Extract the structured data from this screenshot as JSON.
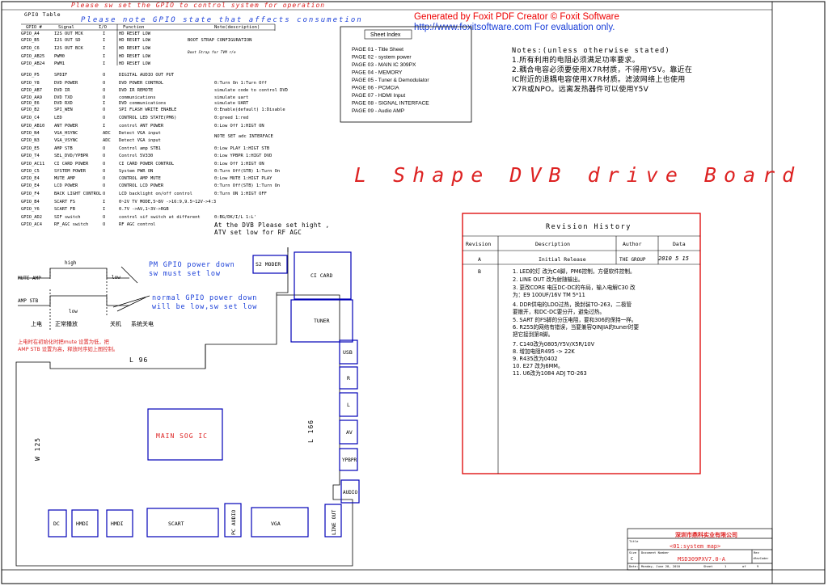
{
  "header": {
    "top_red_note": "Please sw set the GPIO to control system for operation",
    "foxit_line1": "Generated by Foxit PDF Creator © Foxit Software",
    "foxit_line2": "http://www.foxitsoftware.com   For evaluation only."
  },
  "gpio": {
    "table_title": "GPIO Table",
    "note": "Please note GPIO state that affects consumetion",
    "headers": [
      "GPIO #",
      "Signal",
      "I/O",
      "Function",
      "Note(description)"
    ],
    "boot_strap": "BOOT STRAP CONFIGURATION",
    "boot_strap_sub": "Boot Strap for TVM r/e",
    "rows": [
      [
        "GPIO_A4",
        "I2S OUT MCK",
        "I",
        "HD RESET LOW",
        ""
      ],
      [
        "GPIO_B5",
        "I2S OUT SD",
        "I",
        "HD RESET LOW",
        ""
      ],
      [
        "GPIO_C6",
        "I2S OUT BCK",
        "I",
        "HD RESET LOW",
        ""
      ],
      [
        "GPIO_AB25",
        "PWM0",
        "I",
        "HD RESET LOW",
        ""
      ],
      [
        "GPIO_AB24",
        "PWM1",
        "I",
        "HD RESET LOW",
        ""
      ],
      [
        "GPIO_P5",
        "SPDIF",
        "O",
        "DIGITAL AUDIO OUT PUT",
        ""
      ],
      [
        "GPIO_Y8",
        "DVD POWER",
        "O",
        "DVD POWER CONTROL",
        "0:Turn On 1:Turn Off"
      ],
      [
        "GPIO_AB7",
        "DVD IR",
        "O",
        "DVD IR REMOTE",
        "simulate code to control DVD"
      ],
      [
        "GPIO_AA9",
        "DVD TXD",
        "O",
        "communications",
        "simulate uart"
      ],
      [
        "GPIO_E6",
        "DVD RXD",
        "I",
        "DVD communications",
        "simulate UART"
      ],
      [
        "GPIO_B2",
        "SPI_WEN",
        "O",
        "SPI FLASH WRITE ENABLE",
        "0:Enable(default) 1:Disable"
      ],
      [
        "GPIO_C4",
        "LED",
        "O",
        "CONTROL LED STATE(PM6)",
        "0:greed 1:red"
      ],
      [
        "GPIO_AB10",
        "ANT POWER",
        "I",
        "control ANT POWER",
        "0:Low Off    1:HIGT ON"
      ],
      [
        "GPIO_N4",
        "VGA_HSYNC",
        "ADC",
        "Detect VGA input",
        ""
      ],
      [
        "GPIO_N3",
        "VGA_VSYNC",
        "ADC",
        "Detect VGA input",
        ""
      ],
      [
        "GPIO_E5",
        "AMP STB",
        "O",
        "Control amp STB1",
        "0:Low PLAY    1:HIGT STB"
      ],
      [
        "GPIO_T4",
        "SEL_DVD/YPBPR",
        "O",
        "Control 5V330",
        "0:Low YPBPR   1:HIGT DVD"
      ],
      [
        "GPIO_AC11",
        "CI CARD POWER",
        "O",
        "CI CARD POWER CONTROL",
        "0:Low Off    1:HIGT ON"
      ],
      [
        "GPIO_C5",
        "SYSTEM POWER",
        "O",
        "System PWR ON",
        "0:Turn Off(STB)  1:Turn On"
      ],
      [
        "GPIO_E4",
        "MUTE AMP",
        "O",
        "CONTROL AMP MUTE",
        "0:Low MUTE  1:HIGT PLAY"
      ],
      [
        "GPIO_E4",
        "LCD POWER",
        "O",
        "CONTROL LCD POWER",
        "0:Turn Off(STB)  1:Turn On"
      ],
      [
        "GPIO_F4",
        "BACK LIGHT CONTROL",
        "O",
        "LCD backlight on/off control",
        "0:Turn ON  1:HIGT OFF"
      ],
      [
        "GPIO_B4",
        "SCART FS",
        "I",
        "0~2V TV MODE,5~8V ->16:9,9.5~12V->4:3",
        ""
      ],
      [
        "GPIO_Y6",
        "SCART FB",
        "I",
        "0.7V ->AV,1~3V->RGB",
        ""
      ],
      [
        "GPIO_AD2",
        "SIF switch",
        "O",
        "control sif switch at different",
        "0:BG/DK/I/L   1:L'"
      ],
      [
        "GPIO_AC4",
        "RF_AGC  switch",
        "O",
        "RF AGC control",
        ""
      ]
    ],
    "adc_note": "NOTE SET adc INTERFACE",
    "dvb_note_1": "At the DVB Please set hight ,",
    "dvb_note_2": "ATV set low for RF AGC"
  },
  "sheet_index": {
    "title": "Sheet Index",
    "pages": [
      "PAGE 01 - Title Sheet",
      "PAGE 02 - system power",
      "PAGE 03 - MAIN IC 309PX",
      "PAGE 04 - MEMORY",
      "PAGE 05 - Tuner & Demodulator",
      "PAGE 06 - PCMCIA",
      "PAGE 07 - HDMI Input",
      "PAGE 08 - SIGNAL INTERFACE",
      "PAGE 09 - Audio AMP"
    ]
  },
  "notes": {
    "title": "Notes:(unless otherwise stated)",
    "lines": [
      "1.所有利用的电阻必须满足功率要求。",
      "2.耦合电容必须要使用X7R材质，不得用Y5V。靠近在",
      "IC附近的退耦电容使用X7R材质。滤波网络上也使用",
      "X7R或NPO。远离发热器件可以使用Y5V"
    ]
  },
  "board_title": "L Shape DVB drive Board",
  "revision": {
    "title": "Revision History",
    "headers": [
      "Revision",
      "Description",
      "Author",
      "Data"
    ],
    "row_a": {
      "rev": "A",
      "desc": "Initial Release",
      "author": "THE GROUP",
      "date": "2010 5 15"
    },
    "row_b_rev": "B",
    "items": [
      "1. LED的灯 改为C4脚，PM6控制，方便软件控制。",
      "2. LINE OUT 改为射随输出。",
      "3. 更改CORE 电压DC-DC的布局，输入电解C30 改",
      "为：E9 100UF/16V TM 5*11",
      "4. DDR供电的LDO过热，换封装TO-263，二极管",
      "要散开，和DC-DC要分开，避免过热。",
      "5. SART 的FS脚的分压电阻，要和306的保持一样。",
      "6. R255的网络有错误，当要兼容QINJIA的tuner时要",
      "把它接到第8脚。",
      "7. C140改为0805/Y5V/X5R/10V",
      "8. 增加电阻R495 -> 22K",
      "9. R435改为0402",
      "10. E27 改为6MM。",
      "11. U6改为1084 ADJ TO-263"
    ]
  },
  "timing": {
    "high_1": "high",
    "low_1": "low",
    "mute_amp": "MUTE AMP",
    "amp_stb": "AMP STB",
    "low_2": "low",
    "pm_line1": "PM GPIO power down",
    "pm_line2": "sw must set low",
    "normal_line1": "normal GPIO power down",
    "normal_line2": "will be low,sw set low",
    "power_on": "上电",
    "normal_play": "正常播放",
    "shut_down": "关机",
    "sys_off": "系统关电",
    "note_line1": "上电时在初始化时把mute 设置为低，把",
    "note_line2": "AMP STB 设置为高，释放时序如上图控制。"
  },
  "board": {
    "s2_moder": "S2 MODER",
    "ci_card": "CI CARD",
    "tuner": "TUNER",
    "usb": "USB",
    "r": "R",
    "l": "L",
    "av": "AV",
    "ypbpr": "YPBPR",
    "audio": "AUDIO",
    "line_out": "LINE OUT",
    "vga": "VGA",
    "pc_audio": "PC AUDIO",
    "scart": "SCART",
    "hdmi1": "HMDI",
    "hdmi2": "HMDI",
    "dc": "DC",
    "main_ic": "MAIN SOG IC",
    "l96": "L 96",
    "l166": "L 166",
    "w125": "W 125"
  },
  "title_block": {
    "company": "深圳市鼎科实业有限公司",
    "title_label": "Title",
    "title_value": "<01:system map>",
    "size_label": "Size",
    "size_value": "C",
    "docnum_label": "Document Number",
    "docnum_value": "MSD309PXV7.0-A",
    "rev_label": "Rev",
    "rev_value": "<RevCode>",
    "date_label": "Date:",
    "date_value": "Monday, June 28, 2010",
    "sheet_label": "Sheet",
    "sheet_value": "1",
    "of_label": "of",
    "of_value": "9"
  }
}
